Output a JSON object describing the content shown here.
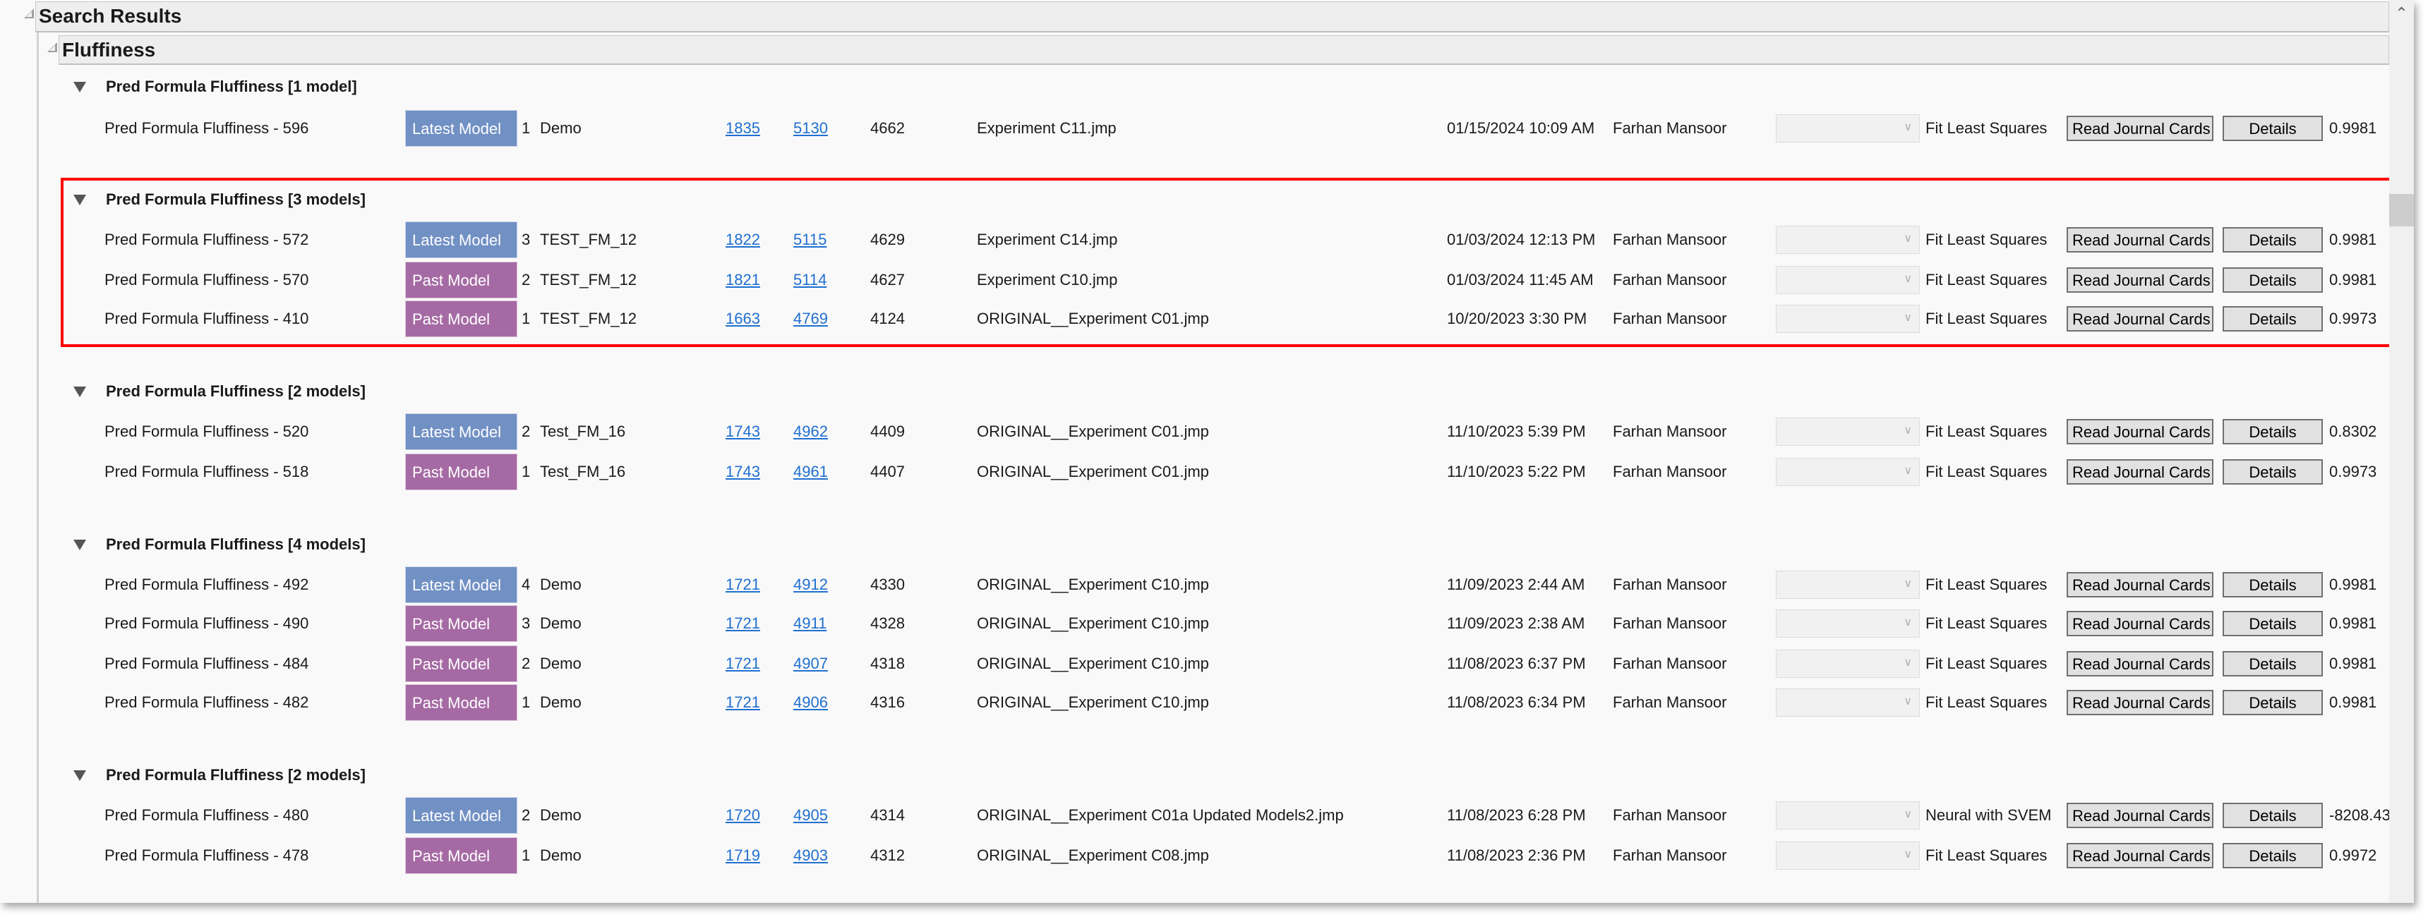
{
  "outline": {
    "root_title": "Search Results",
    "section_title": "Fluffiness"
  },
  "groups": [
    {
      "title": "Pred Formula Fluffiness [1 model]",
      "rows": [
        {
          "name": "Pred Formula Fluffiness - 596",
          "badge": "Latest Model",
          "badge_type": "latest",
          "version": "1",
          "project": "Demo",
          "link1": "1835",
          "link2": "5130",
          "number": "4662",
          "file": "Experiment C11.jmp",
          "date": "01/15/2024 10:09 AM",
          "author": "Farhan Mansoor",
          "dropdown": "",
          "method": "Fit Least Squares",
          "read_btn": "Read Journal Cards",
          "details_btn": "Details",
          "value": "0.9981"
        }
      ]
    },
    {
      "title": "Pred Formula Fluffiness [3 models]",
      "highlighted": true,
      "rows": [
        {
          "name": "Pred Formula Fluffiness - 572",
          "badge": "Latest Model",
          "badge_type": "latest",
          "version": "3",
          "project": "TEST_FM_12",
          "link1": "1822",
          "link2": "5115",
          "number": "4629",
          "file": "Experiment C14.jmp",
          "date": "01/03/2024 12:13 PM",
          "author": "Farhan Mansoor",
          "dropdown": "",
          "method": "Fit Least Squares",
          "read_btn": "Read Journal Cards",
          "details_btn": "Details",
          "value": "0.9981"
        },
        {
          "name": "Pred Formula Fluffiness - 570",
          "badge": "Past Model",
          "badge_type": "past",
          "version": "2",
          "project": "TEST_FM_12",
          "link1": "1821",
          "link2": "5114",
          "number": "4627",
          "file": "Experiment C10.jmp",
          "date": "01/03/2024 11:45 AM",
          "author": "Farhan Mansoor",
          "dropdown": "",
          "method": "Fit Least Squares",
          "read_btn": "Read Journal Cards",
          "details_btn": "Details",
          "value": "0.9981"
        },
        {
          "name": "Pred Formula Fluffiness - 410",
          "badge": "Past Model",
          "badge_type": "past",
          "version": "1",
          "project": "TEST_FM_12",
          "link1": "1663",
          "link2": "4769",
          "number": "4124",
          "file": "ORIGINAL__Experiment C01.jmp",
          "date": "10/20/2023 3:30 PM",
          "author": "Farhan Mansoor",
          "dropdown": "",
          "method": "Fit Least Squares",
          "read_btn": "Read Journal Cards",
          "details_btn": "Details",
          "value": "0.9973"
        }
      ]
    },
    {
      "title": "Pred Formula Fluffiness [2 models]",
      "rows": [
        {
          "name": "Pred Formula Fluffiness - 520",
          "badge": "Latest Model",
          "badge_type": "latest",
          "version": "2",
          "project": "Test_FM_16",
          "link1": "1743",
          "link2": "4962",
          "number": "4409",
          "file": "ORIGINAL__Experiment C01.jmp",
          "date": "11/10/2023 5:39 PM",
          "author": "Farhan Mansoor",
          "dropdown": "",
          "method": "Fit Least Squares",
          "read_btn": "Read Journal Cards",
          "details_btn": "Details",
          "value": "0.8302"
        },
        {
          "name": "Pred Formula Fluffiness - 518",
          "badge": "Past Model",
          "badge_type": "past",
          "version": "1",
          "project": "Test_FM_16",
          "link1": "1743",
          "link2": "4961",
          "number": "4407",
          "file": "ORIGINAL__Experiment C01.jmp",
          "date": "11/10/2023 5:22 PM",
          "author": "Farhan Mansoor",
          "dropdown": "",
          "method": "Fit Least Squares",
          "read_btn": "Read Journal Cards",
          "details_btn": "Details",
          "value": "0.9973"
        }
      ]
    },
    {
      "title": "Pred Formula Fluffiness [4 models]",
      "rows": [
        {
          "name": "Pred Formula Fluffiness - 492",
          "badge": "Latest Model",
          "badge_type": "latest",
          "version": "4",
          "project": "Demo",
          "link1": "1721",
          "link2": "4912",
          "number": "4330",
          "file": "ORIGINAL__Experiment C10.jmp",
          "date": "11/09/2023 2:44 AM",
          "author": "Farhan Mansoor",
          "dropdown": "",
          "method": "Fit Least Squares",
          "read_btn": "Read Journal Cards",
          "details_btn": "Details",
          "value": "0.9981"
        },
        {
          "name": "Pred Formula Fluffiness - 490",
          "badge": "Past Model",
          "badge_type": "past",
          "version": "3",
          "project": "Demo",
          "link1": "1721",
          "link2": "4911",
          "number": "4328",
          "file": "ORIGINAL__Experiment C10.jmp",
          "date": "11/09/2023 2:38 AM",
          "author": "Farhan Mansoor",
          "dropdown": "",
          "method": "Fit Least Squares",
          "read_btn": "Read Journal Cards",
          "details_btn": "Details",
          "value": "0.9981"
        },
        {
          "name": "Pred Formula Fluffiness - 484",
          "badge": "Past Model",
          "badge_type": "past",
          "version": "2",
          "project": "Demo",
          "link1": "1721",
          "link2": "4907",
          "number": "4318",
          "file": "ORIGINAL__Experiment C10.jmp",
          "date": "11/08/2023 6:37 PM",
          "author": "Farhan Mansoor",
          "dropdown": "",
          "method": "Fit Least Squares",
          "read_btn": "Read Journal Cards",
          "details_btn": "Details",
          "value": "0.9981"
        },
        {
          "name": "Pred Formula Fluffiness - 482",
          "badge": "Past Model",
          "badge_type": "past",
          "version": "1",
          "project": "Demo",
          "link1": "1721",
          "link2": "4906",
          "number": "4316",
          "file": "ORIGINAL__Experiment C10.jmp",
          "date": "11/08/2023 6:34 PM",
          "author": "Farhan Mansoor",
          "dropdown": "",
          "method": "Fit Least Squares",
          "read_btn": "Read Journal Cards",
          "details_btn": "Details",
          "value": "0.9981"
        }
      ]
    },
    {
      "title": "Pred Formula Fluffiness [2 models]",
      "rows": [
        {
          "name": "Pred Formula Fluffiness - 480",
          "badge": "Latest Model",
          "badge_type": "latest",
          "version": "2",
          "project": "Demo",
          "link1": "1720",
          "link2": "4905",
          "number": "4314",
          "file": "ORIGINAL__Experiment C01a Updated Models2.jmp",
          "date": "11/08/2023 6:28 PM",
          "author": "Farhan Mansoor",
          "dropdown": "",
          "method": "Neural with SVEM",
          "read_btn": "Read Journal Cards",
          "details_btn": "Details",
          "value": "-8208.43"
        },
        {
          "name": "Pred Formula Fluffiness - 478",
          "badge": "Past Model",
          "badge_type": "past",
          "version": "1",
          "project": "Demo",
          "link1": "1719",
          "link2": "4903",
          "number": "4312",
          "file": "ORIGINAL__Experiment C08.jmp",
          "date": "11/08/2023 2:36 PM",
          "author": "Farhan Mansoor",
          "dropdown": "",
          "method": "Fit Least Squares",
          "read_btn": "Read Journal Cards",
          "details_btn": "Details",
          "value": "0.9972"
        }
      ]
    }
  ],
  "colors": {
    "latest_badge": "#7190c4",
    "past_badge": "#a56aa4",
    "link": "#1f6fd1",
    "highlight_box": "#ff0000"
  },
  "icons": {
    "outline_disclosure": "open-disclosure-triangle-icon",
    "group_disclosure": "expanded-triangle-icon",
    "dropdown_chevron": "chevron-down-icon",
    "scroll_up": "chevron-up-icon"
  }
}
